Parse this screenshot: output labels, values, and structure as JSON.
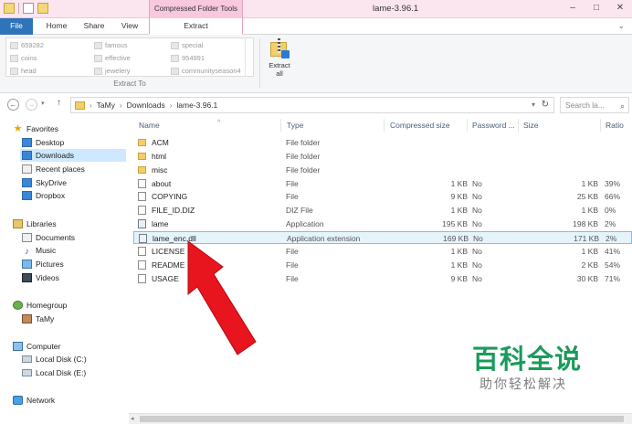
{
  "window": {
    "title": "lame-3.96.1",
    "context_tab_title": "Compressed Folder Tools",
    "minimize": "–",
    "maximize": "□",
    "close": "✕"
  },
  "tabs": {
    "file": "File",
    "home": "Home",
    "share": "Share",
    "view": "View",
    "extract": "Extract"
  },
  "ribbon": {
    "destinations": [
      "659282",
      "famous",
      "special",
      "coins",
      "effective",
      "954991",
      "head",
      "jewelery",
      "communityseason4"
    ],
    "extract_to_label": "Extract To",
    "extract_all_label_1": "Extract",
    "extract_all_label_2": "all"
  },
  "address": {
    "crumbs": [
      "TaMy",
      "Downloads",
      "lame-3.96.1"
    ],
    "search_placeholder": "Search la..."
  },
  "nav": {
    "favorites": "Favorites",
    "desktop": "Desktop",
    "downloads": "Downloads",
    "recent_places": "Recent places",
    "skydrive": "SkyDrive",
    "dropbox": "Dropbox",
    "libraries": "Libraries",
    "documents": "Documents",
    "music": "Music",
    "pictures": "Pictures",
    "videos": "Videos",
    "homegroup": "Homegroup",
    "tamy": "TaMy",
    "computer": "Computer",
    "local_c": "Local Disk (C:)",
    "local_e": "Local Disk (E:)",
    "network": "Network"
  },
  "columns": {
    "name": "Name",
    "type": "Type",
    "compressed_size": "Compressed size",
    "password": "Password ...",
    "size": "Size",
    "ratio": "Ratio"
  },
  "files": [
    {
      "name": "ACM",
      "type": "File folder",
      "csize": "",
      "pw": "",
      "size": "",
      "ratio": "",
      "icon": "folder"
    },
    {
      "name": "html",
      "type": "File folder",
      "csize": "",
      "pw": "",
      "size": "",
      "ratio": "",
      "icon": "folder"
    },
    {
      "name": "misc",
      "type": "File folder",
      "csize": "",
      "pw": "",
      "size": "",
      "ratio": "",
      "icon": "folder"
    },
    {
      "name": "about",
      "type": "File",
      "csize": "1 KB",
      "pw": "No",
      "size": "1 KB",
      "ratio": "39%",
      "icon": "file"
    },
    {
      "name": "COPYING",
      "type": "File",
      "csize": "9 KB",
      "pw": "No",
      "size": "25 KB",
      "ratio": "66%",
      "icon": "file"
    },
    {
      "name": "FILE_ID.DIZ",
      "type": "DIZ File",
      "csize": "1 KB",
      "pw": "No",
      "size": "1 KB",
      "ratio": "0%",
      "icon": "file"
    },
    {
      "name": "lame",
      "type": "Application",
      "csize": "195 KB",
      "pw": "No",
      "size": "198 KB",
      "ratio": "2%",
      "icon": "app"
    },
    {
      "name": "lame_enc.dll",
      "type": "Application extension",
      "csize": "169 KB",
      "pw": "No",
      "size": "171 KB",
      "ratio": "2%",
      "icon": "dll"
    },
    {
      "name": "LICENSE",
      "type": "File",
      "csize": "1 KB",
      "pw": "No",
      "size": "1 KB",
      "ratio": "41%",
      "icon": "file"
    },
    {
      "name": "README",
      "type": "File",
      "csize": "1 KB",
      "pw": "No",
      "size": "2 KB",
      "ratio": "54%",
      "icon": "file"
    },
    {
      "name": "USAGE",
      "type": "File",
      "csize": "9 KB",
      "pw": "No",
      "size": "30 KB",
      "ratio": "71%",
      "icon": "file"
    }
  ],
  "watermark": {
    "logo": "百科全说",
    "subtitle": "助你轻松解决"
  },
  "colors": {
    "accent": "#2f73b9",
    "context_tab": "#f7c8de",
    "highlight_border": "#7cc1e8",
    "arrow": "#e8141e",
    "watermark": "#1a9b5a"
  }
}
